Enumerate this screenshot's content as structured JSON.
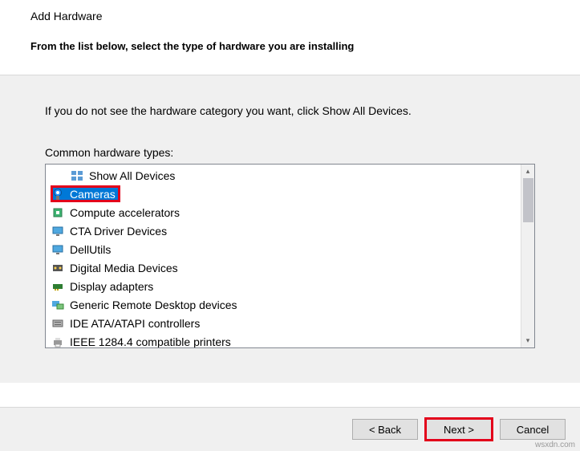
{
  "header": {
    "title": "Add Hardware",
    "subtitle": "From the list below, select the type of hardware you are installing"
  },
  "body": {
    "instruction": "If you do not see the hardware category you want, click Show All Devices.",
    "list_label": "Common hardware types:",
    "items": [
      {
        "icon": "show-all-devices-icon",
        "label": "Show All Devices"
      },
      {
        "icon": "camera-icon",
        "label": "Cameras",
        "selected": true,
        "highlighted": true
      },
      {
        "icon": "compute-accel-icon",
        "label": "Compute accelerators"
      },
      {
        "icon": "monitor-icon",
        "label": "CTA Driver Devices"
      },
      {
        "icon": "monitor-icon",
        "label": "DellUtils"
      },
      {
        "icon": "media-device-icon",
        "label": "Digital Media Devices"
      },
      {
        "icon": "display-adapter-icon",
        "label": "Display adapters"
      },
      {
        "icon": "remote-desktop-icon",
        "label": "Generic Remote Desktop devices"
      },
      {
        "icon": "ide-controller-icon",
        "label": "IDE ATA/ATAPI controllers"
      },
      {
        "icon": "printer-icon",
        "label": "IEEE 1284.4 compatible printers"
      }
    ]
  },
  "footer": {
    "back": "< Back",
    "next": "Next >",
    "cancel": "Cancel"
  },
  "watermark": "wsxdn.com"
}
